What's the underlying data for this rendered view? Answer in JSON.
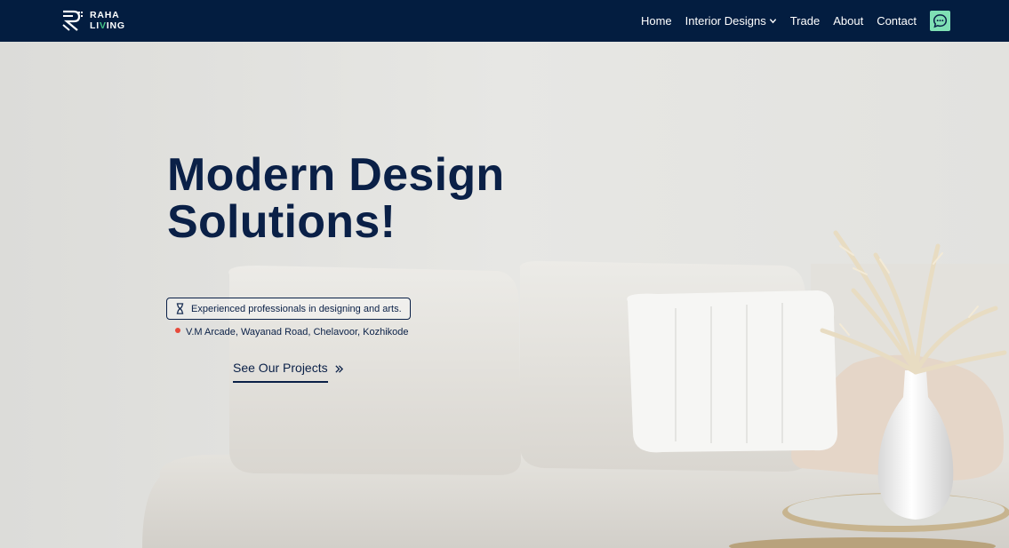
{
  "brand": {
    "line1": "RAHA",
    "line2_pre": "LI",
    "line2_accent": "V",
    "line2_post": "ING"
  },
  "nav": {
    "items": [
      {
        "label": "Home"
      },
      {
        "label": "Interior Designs"
      },
      {
        "label": "Trade"
      },
      {
        "label": "About"
      },
      {
        "label": "Contact"
      }
    ],
    "chat_icon": "chat-bubble-icon"
  },
  "hero": {
    "title_line1": "Modern Design",
    "title_line2": "Solutions!",
    "badge_text": "Experienced professionals in designing and arts.",
    "badge_icon": "hourglass-icon",
    "address": "V.M Arcade, Wayanad Road, Chelavoor, Kozhikode",
    "cta_label": "See Our Projects",
    "cta_icon": "double-chevron-right-icon"
  },
  "colors": {
    "navbar_bg": "#031d40",
    "accent_green": "#45c486",
    "chat_button": "#7fe0b4",
    "heading": "#0a2047",
    "address_dot": "#e74a3b"
  }
}
